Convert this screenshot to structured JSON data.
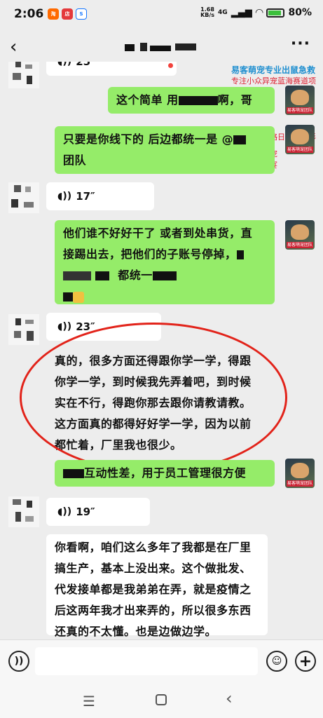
{
  "status_bar": {
    "time": "2:06",
    "net_speed": "1.68",
    "net_unit": "KB/s",
    "net_type": "4G",
    "battery": "80%"
  },
  "title_bar": {
    "back_icon": "chevron-left-icon",
    "more_icon": "more-icon"
  },
  "marquee": {
    "line1": "易客萌宠专业出鼠急救",
    "line2": "专注小众异宠蓝海赛道项目",
    "line3": "教学饲养攻略日常护理形",
    "line4": "我们共享异宠",
    "line5": "利润市场盛宴"
  },
  "messages": {
    "voice1": "25″",
    "m1_a": "这个简单 用",
    "m1_b": "啊，哥",
    "m2_a": "只要是你线下的 后边都统一是 @",
    "m2_b": "团队",
    "voice2": "17″",
    "m3_line1": "他们谁不好好干了 或者到处串货，直",
    "m3_line2": "接踢出去，把他们的子账号停掉，",
    "m3_line3": "都统一",
    "voice3": "23″",
    "m4_line1": "真的，很多方面还得跟你学一学，得跟",
    "m4_line2": "你学一学，到时候我先弄着吧，到时候",
    "m4_line3": "实在不行，得跑你那去跟你请教请教。",
    "m4_line4": "这方面真的都得好好学一学，因为以前",
    "m4_line5": "都忙着，厂里我也很少。",
    "m5": "互动性差，用于员工管理很方便",
    "voice4": "19″",
    "m6_line1": "你看啊，咱们这么多年了我都是在厂里",
    "m6_line2": "搞生产，基本上没出来。这个做批发、",
    "m6_line3": "代发接单都是我弟弟在弄，就是疫情之",
    "m6_line4": "后这两年我才出来弄的，所以很多东西",
    "m6_line5": "还真的不太懂。也是边做边学。"
  },
  "avatar_tag": "易客萌宠团队",
  "input_bar": {
    "voice_icon": "voice-icon",
    "emoji_icon": "emoji-icon",
    "plus_icon": "plus-icon"
  },
  "colors": {
    "green_bubble": "#95ec69",
    "highlight": "#e2231a",
    "background": "#ededed"
  }
}
